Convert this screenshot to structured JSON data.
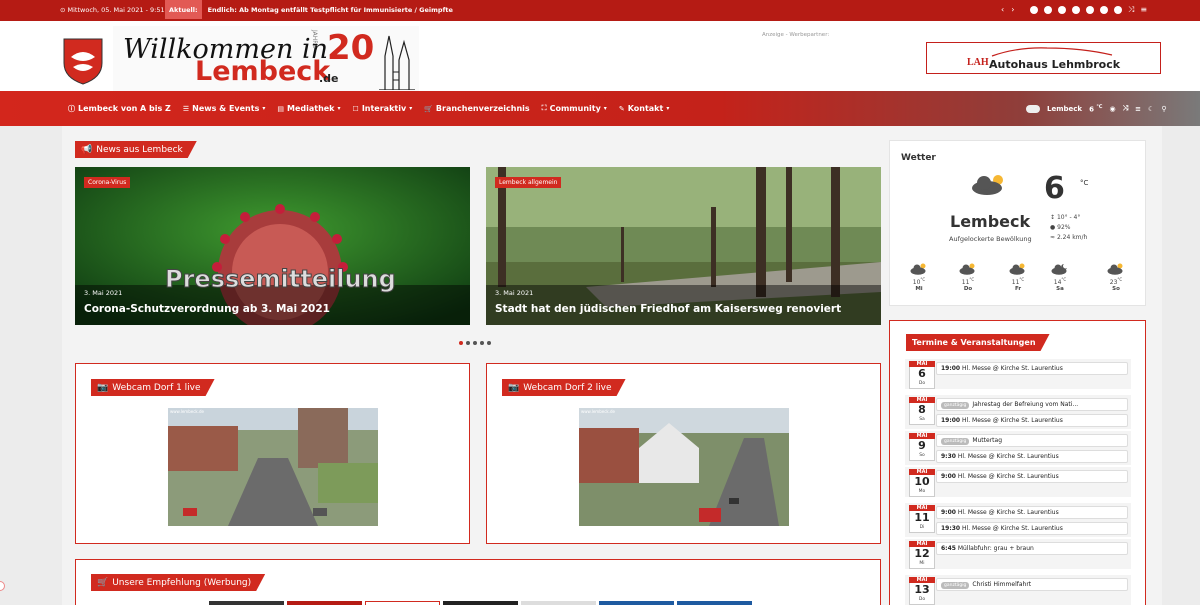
{
  "topbar": {
    "date": "Mittwoch, 05. Mai 2021 - 9:51",
    "aktuell_label": "Aktuell:",
    "ticker": "Endlich: Ab Montag entfällt Testpflicht für Immunisierte / Geimpfte"
  },
  "header": {
    "logo_line1": "Willkommen in",
    "logo_line2": "Lembeck",
    "logo_tld": ".de",
    "logo_anniversary": "20",
    "logo_jahre": "JAHRE",
    "ad_label": "Anzeige - Werbepartner:",
    "ad_brand_mark": "LAH",
    "ad_brand": "Autohaus Lehmbrock"
  },
  "nav": {
    "items": [
      {
        "label": "Lembeck von A bis Z",
        "icon": "info-icon",
        "dropdown": false
      },
      {
        "label": "News & Events",
        "icon": "list-icon",
        "dropdown": true
      },
      {
        "label": "Mediathek",
        "icon": "media-icon",
        "dropdown": true
      },
      {
        "label": "Interaktiv",
        "icon": "chat-icon",
        "dropdown": true
      },
      {
        "label": "Branchenverzeichnis",
        "icon": "cart-icon",
        "dropdown": false
      },
      {
        "label": "Community",
        "icon": "community-icon",
        "dropdown": true
      },
      {
        "label": "Kontakt",
        "icon": "pen-icon",
        "dropdown": true
      }
    ],
    "weather_city": "Lembeck",
    "weather_temp": "6"
  },
  "news": {
    "section_title": "News aus Lembeck",
    "slides": [
      {
        "category": "Corona-Virus",
        "date": "3. Mai 2021",
        "title": "Corona-Schutzverordnung ab 3. Mai 2021",
        "overlay": "Pressemitteilung"
      },
      {
        "category": "Lembeck allgemein",
        "date": "3. Mai 2021",
        "title": "Stadt hat den jüdischen Friedhof am Kaisersweg renoviert"
      }
    ]
  },
  "webcams": [
    {
      "title": "Webcam Dorf 1 live",
      "stamp": "www.lembeck.de"
    },
    {
      "title": "Webcam Dorf 2 live",
      "stamp": "www.lembeck.de"
    }
  ],
  "empfehlung": {
    "title": "Unsere Empfehlung (Werbung)"
  },
  "weather": {
    "title": "Wetter",
    "temp": "6",
    "unit": "°C",
    "city": "Lembeck",
    "desc": "Aufgelockerte Bewölkung",
    "range": "10° - 4°",
    "humidity": "92%",
    "wind": "2.24 km/h",
    "forecast": [
      {
        "temp": "10",
        "day": "Mi"
      },
      {
        "temp": "11",
        "day": "Do"
      },
      {
        "temp": "11",
        "day": "Fr"
      },
      {
        "temp": "14",
        "day": "Sa"
      },
      {
        "temp": "23",
        "day": "So"
      }
    ]
  },
  "termine": {
    "title": "Termine & Veranstaltungen",
    "ganztaegig_label": "ganztägig",
    "days": [
      {
        "month": "MAI",
        "day": "6",
        "weekday": "Do",
        "events": [
          {
            "time": "19:00",
            "text": "Hl. Messe @ Kirche St. Laurentius"
          }
        ]
      },
      {
        "month": "MAI",
        "day": "8",
        "weekday": "Sa",
        "events": [
          {
            "allday": true,
            "text": "Jahrestag der Befreiung vom Nati..."
          },
          {
            "time": "19:00",
            "text": "Hl. Messe @ Kirche St. Laurentius"
          }
        ]
      },
      {
        "month": "MAI",
        "day": "9",
        "weekday": "So",
        "events": [
          {
            "allday": true,
            "text": "Muttertag"
          },
          {
            "time": "9:30",
            "text": "Hl. Messe @ Kirche St. Laurentius"
          }
        ]
      },
      {
        "month": "MAI",
        "day": "10",
        "weekday": "Mo",
        "events": [
          {
            "time": "9:00",
            "text": "Hl. Messe @ Kirche St. Laurentius"
          }
        ]
      },
      {
        "month": "MAI",
        "day": "11",
        "weekday": "Di",
        "events": [
          {
            "time": "9:00",
            "text": "Hl. Messe @ Kirche St. Laurentius"
          },
          {
            "time": "19:30",
            "text": "Hl. Messe @ Kirche St. Laurentius"
          }
        ]
      },
      {
        "month": "MAI",
        "day": "12",
        "weekday": "Mi",
        "events": [
          {
            "time": "6:45",
            "text": "Müllabfuhr: grau + braun"
          }
        ]
      },
      {
        "month": "MAI",
        "day": "13",
        "weekday": "Do",
        "events": [
          {
            "allday": true,
            "text": "Christi Himmelfahrt"
          }
        ]
      }
    ]
  },
  "colors": {
    "brand_red": "#d12a1f",
    "topbar": "#b51b14"
  }
}
